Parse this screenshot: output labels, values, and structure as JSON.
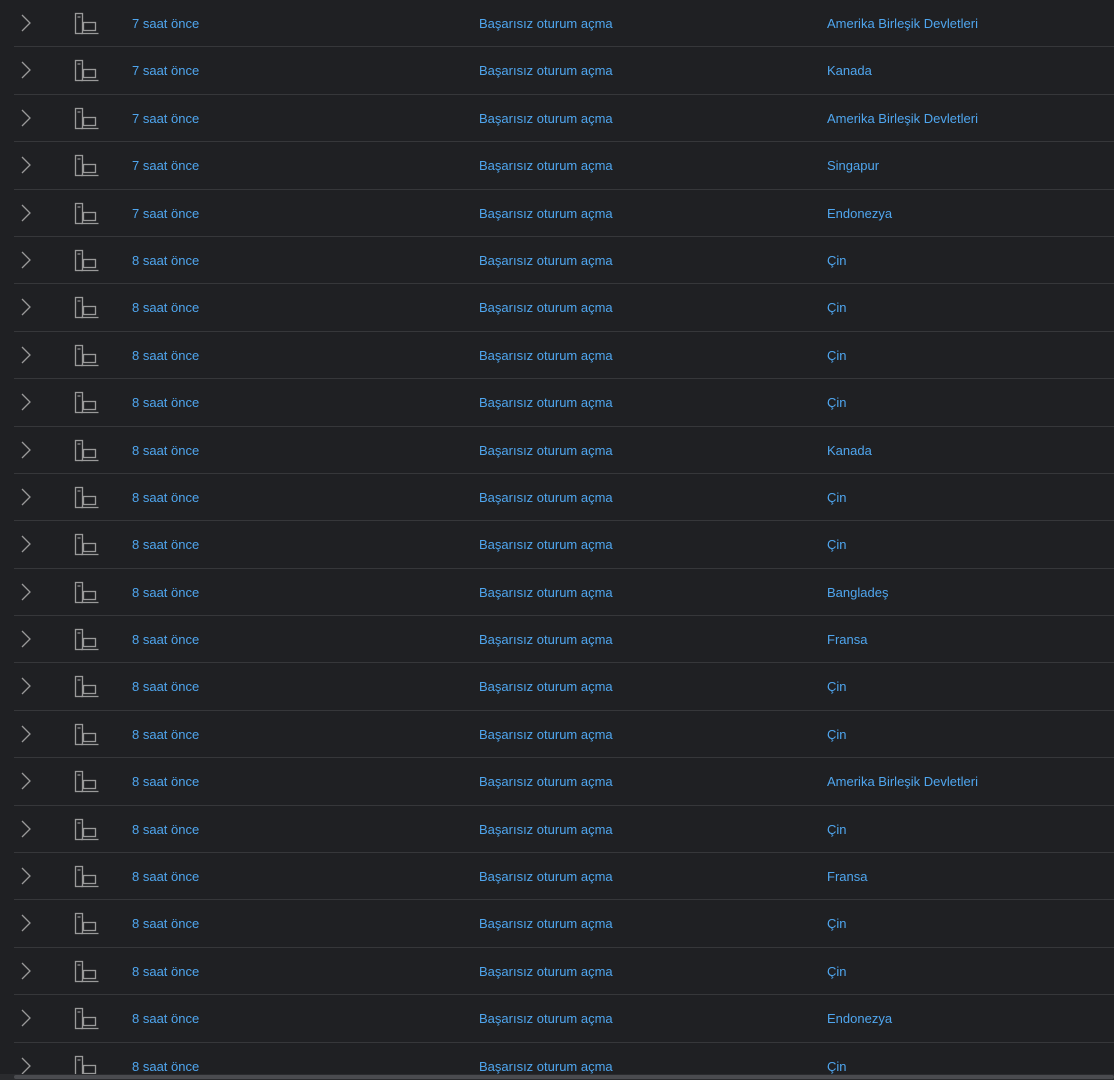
{
  "colors": {
    "background": "#1f2023",
    "link": "#4fa6ef",
    "divider": "#36373a",
    "icon": "#9a9a9a"
  },
  "icons": {
    "expand": "chevron-right-icon",
    "device": "computer-device-icon"
  },
  "rows": [
    {
      "time": "7 saat önce",
      "event": "Başarısız oturum açma",
      "location": "Amerika Birleşik Devletleri"
    },
    {
      "time": "7 saat önce",
      "event": "Başarısız oturum açma",
      "location": "Kanada"
    },
    {
      "time": "7 saat önce",
      "event": "Başarısız oturum açma",
      "location": "Amerika Birleşik Devletleri"
    },
    {
      "time": "7 saat önce",
      "event": "Başarısız oturum açma",
      "location": "Singapur"
    },
    {
      "time": "7 saat önce",
      "event": "Başarısız oturum açma",
      "location": "Endonezya"
    },
    {
      "time": "8 saat önce",
      "event": "Başarısız oturum açma",
      "location": "Çin"
    },
    {
      "time": "8 saat önce",
      "event": "Başarısız oturum açma",
      "location": "Çin"
    },
    {
      "time": "8 saat önce",
      "event": "Başarısız oturum açma",
      "location": "Çin"
    },
    {
      "time": "8 saat önce",
      "event": "Başarısız oturum açma",
      "location": "Çin"
    },
    {
      "time": "8 saat önce",
      "event": "Başarısız oturum açma",
      "location": "Kanada"
    },
    {
      "time": "8 saat önce",
      "event": "Başarısız oturum açma",
      "location": "Çin"
    },
    {
      "time": "8 saat önce",
      "event": "Başarısız oturum açma",
      "location": "Çin"
    },
    {
      "time": "8 saat önce",
      "event": "Başarısız oturum açma",
      "location": "Bangladeş"
    },
    {
      "time": "8 saat önce",
      "event": "Başarısız oturum açma",
      "location": "Fransa"
    },
    {
      "time": "8 saat önce",
      "event": "Başarısız oturum açma",
      "location": "Çin"
    },
    {
      "time": "8 saat önce",
      "event": "Başarısız oturum açma",
      "location": "Çin"
    },
    {
      "time": "8 saat önce",
      "event": "Başarısız oturum açma",
      "location": "Amerika Birleşik Devletleri"
    },
    {
      "time": "8 saat önce",
      "event": "Başarısız oturum açma",
      "location": "Çin"
    },
    {
      "time": "8 saat önce",
      "event": "Başarısız oturum açma",
      "location": "Fransa"
    },
    {
      "time": "8 saat önce",
      "event": "Başarısız oturum açma",
      "location": "Çin"
    },
    {
      "time": "8 saat önce",
      "event": "Başarısız oturum açma",
      "location": "Çin"
    },
    {
      "time": "8 saat önce",
      "event": "Başarısız oturum açma",
      "location": "Endonezya"
    },
    {
      "time": "8 saat önce",
      "event": "Başarısız oturum açma",
      "location": "Çin"
    }
  ]
}
